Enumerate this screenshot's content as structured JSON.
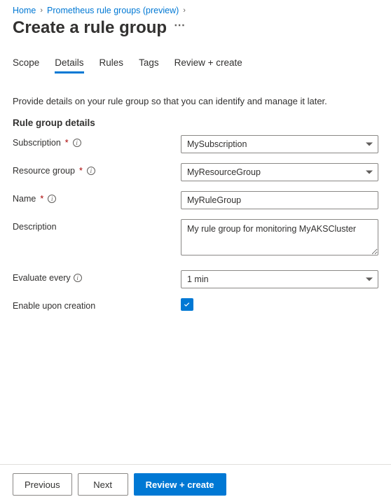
{
  "breadcrumb": {
    "home": "Home",
    "parent": "Prometheus rule groups (preview)"
  },
  "page": {
    "title": "Create a rule group"
  },
  "tabs": {
    "scope": "Scope",
    "details": "Details",
    "rules": "Rules",
    "tags": "Tags",
    "review": "Review + create",
    "active": "details"
  },
  "intro": "Provide details on your rule group so that you can identify and manage it later.",
  "section_label": "Rule group details",
  "fields": {
    "subscription": {
      "label": "Subscription",
      "value": "MySubscription",
      "required": true,
      "info": true
    },
    "resource_group": {
      "label": "Resource group",
      "value": "MyResourceGroup",
      "required": true,
      "info": true
    },
    "name": {
      "label": "Name",
      "value": "MyRuleGroup",
      "required": true,
      "info": true
    },
    "description": {
      "label": "Description",
      "value": "My rule group for monitoring MyAKSCluster"
    },
    "evaluate_every": {
      "label": "Evaluate every",
      "value": "1 min",
      "info": true
    },
    "enable": {
      "label": "Enable upon creation",
      "checked": true
    }
  },
  "footer": {
    "previous": "Previous",
    "next": "Next",
    "review_create": "Review + create"
  }
}
